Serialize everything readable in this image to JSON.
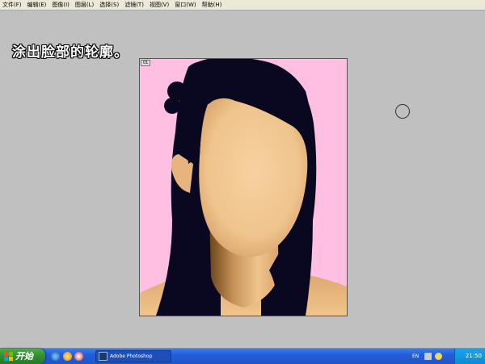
{
  "menu": [
    {
      "label": "文件(F)"
    },
    {
      "label": "编辑(E)"
    },
    {
      "label": "图像(I)"
    },
    {
      "label": "图层(L)"
    },
    {
      "label": "选择(S)"
    },
    {
      "label": "滤镜(T)"
    },
    {
      "label": "视图(V)"
    },
    {
      "label": "窗口(W)"
    },
    {
      "label": "帮助(H)"
    }
  ],
  "caption": "涂出脸部的轮廓。",
  "document": {
    "tag": "01",
    "background_color": "#ffbfe2",
    "hair_color": "#0a0820",
    "skin_color": "#f2c690"
  },
  "taskbar": {
    "start_label": "开始",
    "task_label": "Adobe Photoshop",
    "lang": "EN",
    "clock": "21:50"
  },
  "colors": {
    "taskbar_blue": "#245edb",
    "start_green": "#2f8e2f",
    "canvas_gray": "#c0c0c0"
  }
}
